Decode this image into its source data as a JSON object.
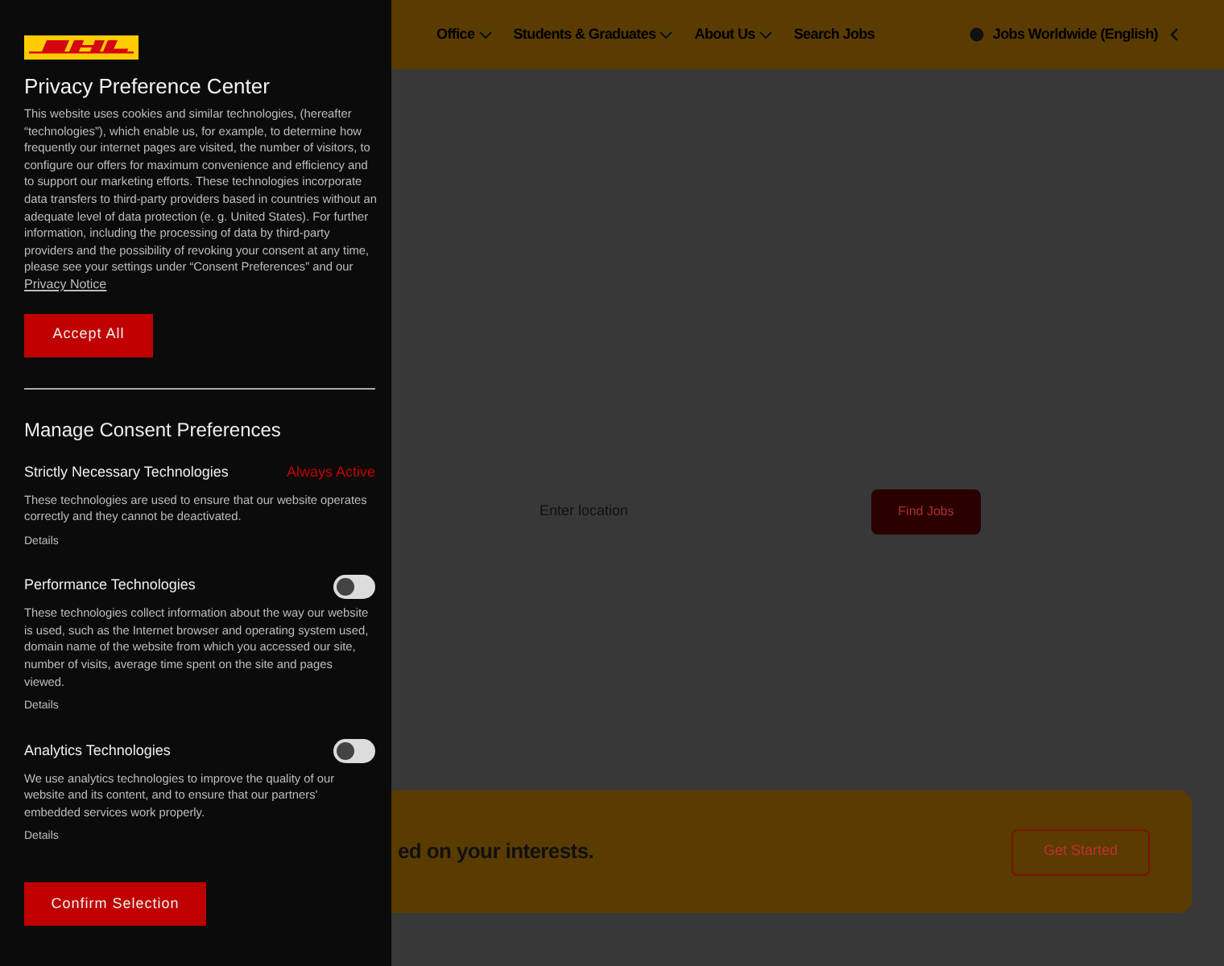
{
  "nav": {
    "items": [
      {
        "label": "Office",
        "has_menu": true
      },
      {
        "label": "Students & Graduates",
        "has_menu": true
      },
      {
        "label": "About Us",
        "has_menu": true
      },
      {
        "label": "Search Jobs",
        "has_menu": false
      }
    ],
    "locale": "Jobs Worldwide (English)"
  },
  "search": {
    "placeholder": "Enter location",
    "button": "Find Jobs"
  },
  "banner": {
    "text": "ed on your interests.",
    "button": "Get Started"
  },
  "privacy_panel": {
    "title": "Privacy Preference Center",
    "intro": "This website uses cookies and similar technologies, (hereafter “technologies”), which enable us, for example, to determine how frequently our internet pages are visited, the number of visitors, to configure our offers for maximum convenience and efficiency and to support our marketing efforts. These technologies incorporate data transfers to third-party providers based in countries without an adequate level of data protection (e. g. United States). For further information, including the processing of data by third-party providers and the possibility of revoking your consent at any time, please see your settings under “Consent Preferences” and our",
    "privacy_link": "Privacy Notice",
    "accept_button": "Accept All",
    "manage_title": "Manage Consent Preferences",
    "categories": [
      {
        "kind": "fixed",
        "name": "Strictly Necessary Technologies",
        "status": "Always Active",
        "description": "These technologies are used to ensure that our website operates correctly and they cannot be deactivated.",
        "details": "Details"
      },
      {
        "kind": "toggle",
        "name": "Performance Technologies",
        "on": false,
        "description": "These technologies collect information about the way our website is used, such as the Internet browser and operating system used, domain name of the website from which you accessed our site, number of visits, average time spent on the site and pages viewed.",
        "details": "Details"
      },
      {
        "kind": "toggle",
        "name": "Analytics Technologies",
        "on": false,
        "description": "We use analytics technologies to improve the quality of our website and its content, and to ensure that our partners' embedded services work properly.",
        "details": "Details"
      }
    ],
    "confirm_button": "Confirm Selection"
  }
}
